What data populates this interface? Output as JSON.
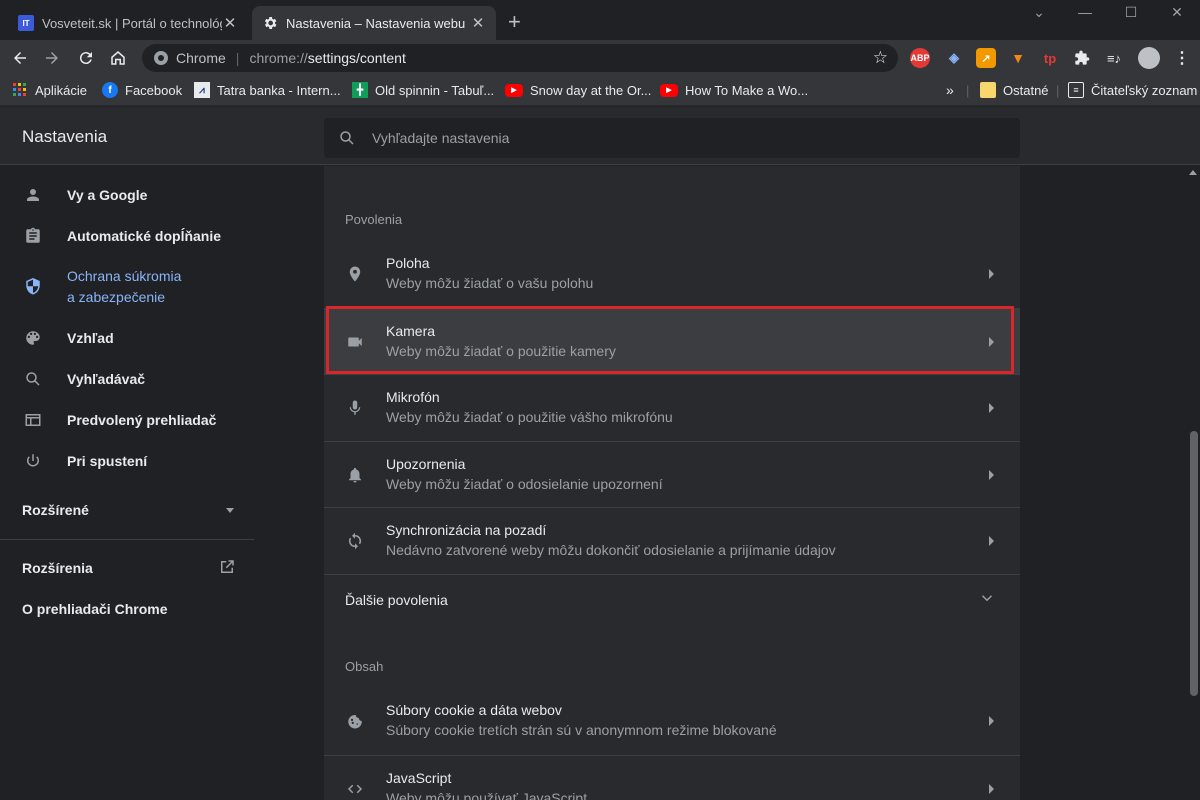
{
  "browser": {
    "tabs": [
      {
        "title": "Vosveteit.sk | Portál o technológi",
        "favicon": "IT"
      },
      {
        "title": "Nastavenia – Nastavenia webu"
      }
    ],
    "omnibox": {
      "chrome_label": "Chrome",
      "url_prefix": "chrome://",
      "url_path": "settings/content"
    },
    "extensions": [
      {
        "name": "ABP",
        "color": "#e53935"
      },
      {
        "name": "tp",
        "color": "#e53935"
      }
    ],
    "bookmarks": [
      {
        "label": "Aplikácie"
      },
      {
        "label": "Facebook"
      },
      {
        "label": "Tatra banka - Intern..."
      },
      {
        "label": "Old spinnin - Tabuľ..."
      },
      {
        "label": "Snow day at the Or..."
      },
      {
        "label": "How To Make a Wo..."
      }
    ],
    "bookmarks_overflow": "»",
    "other_bookmarks": "Ostatné",
    "reading_list": "Čitateľský zoznam"
  },
  "settings": {
    "title": "Nastavenia",
    "search_placeholder": "Vyhľadajte nastavenia",
    "sidebar": {
      "items": [
        {
          "label": "Vy a Google",
          "icon": "person-icon"
        },
        {
          "label": "Automatické dopĺňanie",
          "icon": "clipboard-icon"
        },
        {
          "label": "Ochrana súkromia a zabezpečenie",
          "line1": "Ochrana súkromia",
          "line2": "a zabezpečenie",
          "icon": "shield-icon",
          "selected": true
        },
        {
          "label": "Vzhľad",
          "icon": "palette-icon"
        },
        {
          "label": "Vyhľadávač",
          "icon": "search-icon"
        },
        {
          "label": "Predvolený prehliadač",
          "icon": "browser-icon"
        },
        {
          "label": "Pri spustení",
          "icon": "power-icon"
        }
      ],
      "advanced": "Rozšírené",
      "extensions": "Rozšírenia",
      "about": "O prehliadači Chrome"
    },
    "main": {
      "permissions_title": "Povolenia",
      "permissions": [
        {
          "title": "Poloha",
          "subtitle": "Weby môžu žiadať o vašu polohu",
          "icon": "location-icon"
        },
        {
          "title": "Kamera",
          "subtitle": "Weby môžu žiadať o použitie kamery",
          "icon": "camera-icon",
          "highlighted": true
        },
        {
          "title": "Mikrofón",
          "subtitle": "Weby môžu žiadať o použitie vášho mikrofónu",
          "icon": "microphone-icon"
        },
        {
          "title": "Upozornenia",
          "subtitle": "Weby môžu žiadať o odosielanie upozornení",
          "icon": "bell-icon"
        },
        {
          "title": "Synchronizácia na pozadí",
          "subtitle": "Nedávno zatvorené weby môžu dokončiť odosielanie a prijímanie údajov",
          "icon": "sync-icon"
        }
      ],
      "more_permissions": "Ďalšie povolenia",
      "content_title": "Obsah",
      "content": [
        {
          "title": "Súbory cookie a dáta webov",
          "subtitle": "Súbory cookie tretích strán sú v anonymnom režime blokované",
          "icon": "cookie-icon"
        },
        {
          "title": "JavaScript",
          "subtitle": "Weby môžu používať JavaScript",
          "icon": "code-icon"
        }
      ]
    }
  }
}
